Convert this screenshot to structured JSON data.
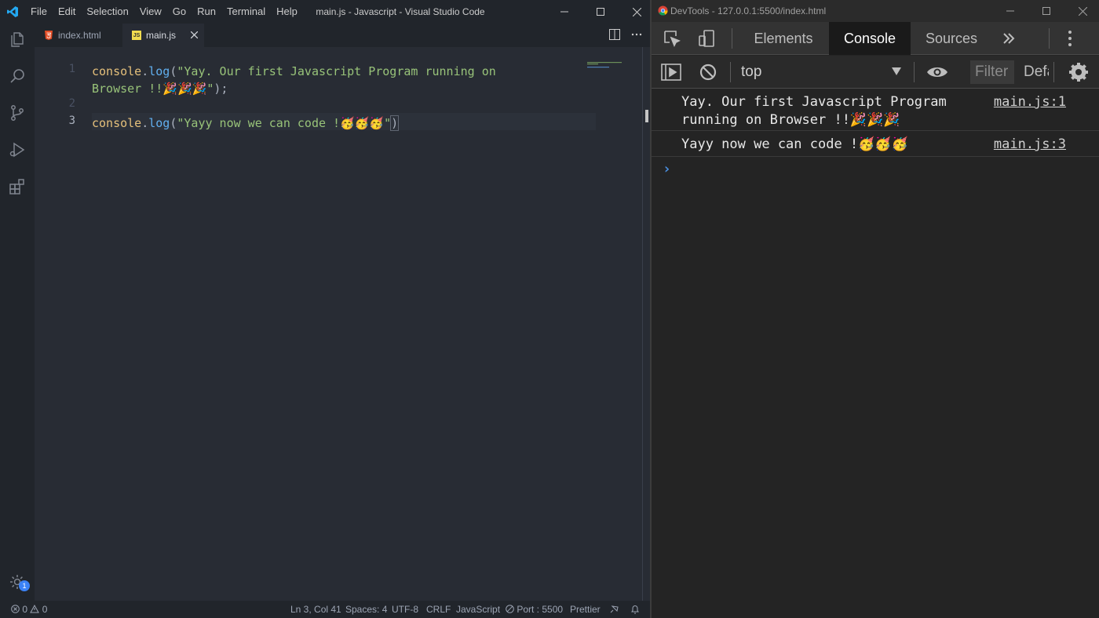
{
  "vscode": {
    "window_title": "main.js - Javascript - Visual Studio Code",
    "menu": [
      "File",
      "Edit",
      "Selection",
      "View",
      "Go",
      "Run",
      "Terminal",
      "Help"
    ],
    "tabs": [
      {
        "label": "index.html",
        "icon": "html5-icon",
        "active": false
      },
      {
        "label": "main.js",
        "icon": "js-icon",
        "active": true
      }
    ],
    "editor": {
      "line_numbers": [
        "1",
        "2",
        "3"
      ],
      "line1": {
        "obj": "console",
        "dot": ".",
        "fn": "log",
        "open": "(",
        "str": "\"Yay. Our first Javascript Program running on",
        "str2": "Browser !!🎉🎉🎉\"",
        "close": ");"
      },
      "line3": {
        "obj": "console",
        "dot": ".",
        "fn": "log",
        "open": "(",
        "str": "\"Yayy now we can code !🥳🥳🥳\"",
        "close": ")"
      }
    },
    "statusbar": {
      "errors": "0",
      "warnings": "0",
      "position": "Ln 3, Col 41",
      "spaces": "Spaces: 4",
      "encoding": "UTF-8",
      "eol": "CRLF",
      "language": "JavaScript",
      "port": "Port : 5500",
      "formatter": "Prettier"
    },
    "settings_badge": "1",
    "colors": {
      "accent": "#3b82f6",
      "bg": "#282c34",
      "string": "#98c379",
      "function": "#61afef",
      "object": "#e5c07b"
    }
  },
  "devtools": {
    "window_title": "DevTools - 127.0.0.1:5500/index.html",
    "tabs": [
      {
        "label": "Elements",
        "active": false
      },
      {
        "label": "Console",
        "active": true
      },
      {
        "label": "Sources",
        "active": false
      }
    ],
    "context": "top",
    "filter_placeholder": "Filter",
    "levels": "Default levels",
    "messages": [
      {
        "text": "Yay. Our first Javascript Program running on Browser !!🎉🎉🎉",
        "source": "main.js:1"
      },
      {
        "text": "Yayy now we can code !🥳🥳🥳",
        "source": "main.js:3"
      }
    ],
    "prompt": "›"
  }
}
